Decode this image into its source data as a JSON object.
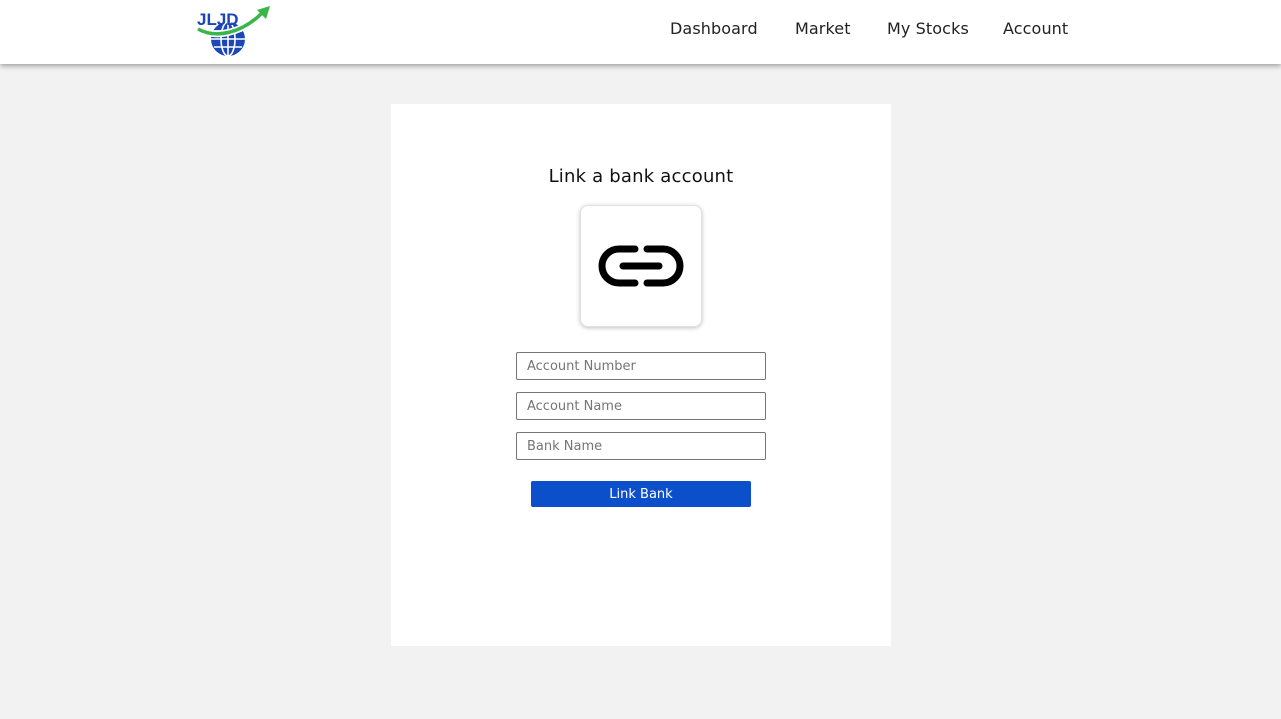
{
  "brand": {
    "logo_text": "JLJD",
    "logo_icon": "globe-with-rising-arrow-logo",
    "colors": {
      "blue": "#1a46b8",
      "green": "#39b54a"
    }
  },
  "nav": {
    "items": [
      {
        "label": "Dashboard"
      },
      {
        "label": "Market"
      },
      {
        "label": "My Stocks"
      },
      {
        "label": "Account"
      }
    ]
  },
  "card": {
    "title": "Link a bank account",
    "icon": "chain-link-icon",
    "fields": {
      "account_number": {
        "placeholder": "Account Number",
        "value": ""
      },
      "account_name": {
        "placeholder": "Account Name",
        "value": ""
      },
      "bank_name": {
        "placeholder": "Bank Name",
        "value": ""
      }
    },
    "submit_label": "Link Bank"
  },
  "theme": {
    "page_background": "#f2f2f2",
    "card_background": "#ffffff",
    "accent": "#0b4fcb"
  }
}
